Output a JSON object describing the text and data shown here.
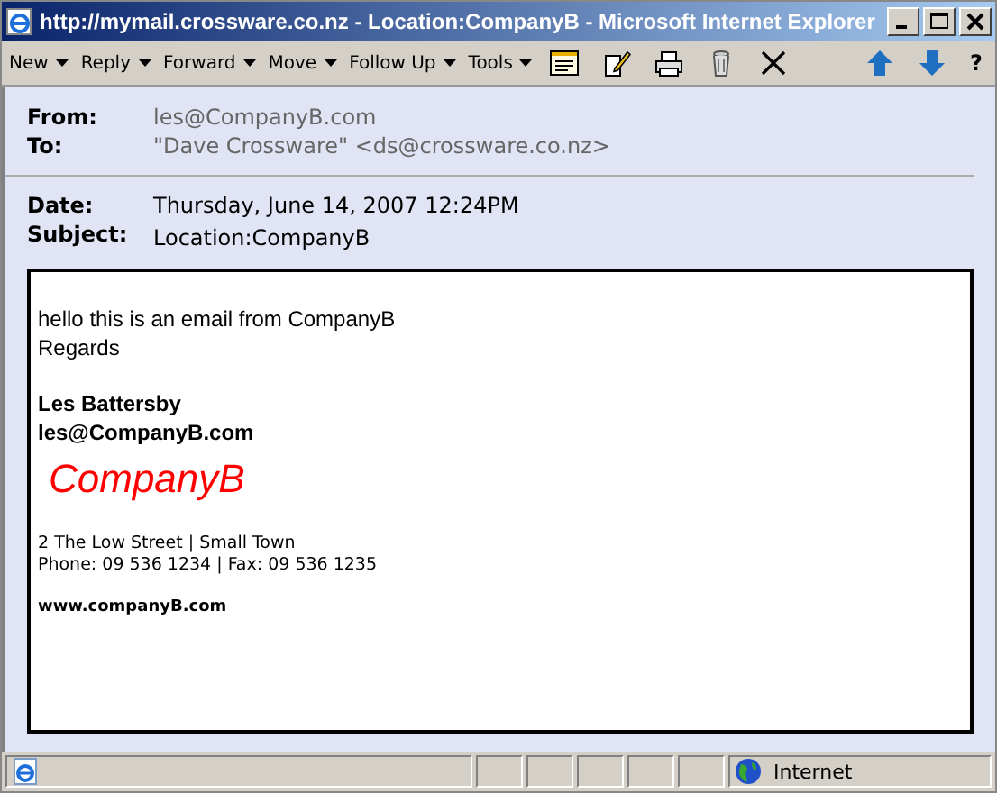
{
  "window": {
    "title": "http://mymail.crossware.co.nz - Location:CompanyB - Microsoft Internet Explorer"
  },
  "toolbar": {
    "menus": [
      "New",
      "Reply",
      "Forward",
      "Move",
      "Follow Up",
      "Tools"
    ],
    "help": "?"
  },
  "header": {
    "from_label": "From:",
    "from": "les@CompanyB.com",
    "to_label": "To:",
    "to": "\"Dave Crossware\" <ds@crossware.co.nz>",
    "date_label": "Date:",
    "date": "Thursday, June 14, 2007 12:24PM",
    "subject_label": "Subject:",
    "subject": "Location:CompanyB"
  },
  "body": {
    "lines": [
      "hello this is an email from CompanyB",
      "Regards"
    ],
    "signature_name": "Les Battersby",
    "signature_email": "les@CompanyB.com",
    "logo": "CompanyB",
    "address": "2 The Low Street | Small Town",
    "phone": "Phone: 09 536 1234 | Fax: 09 536 1235",
    "website": "www.companyB.com"
  },
  "status_bar": {
    "zone": "Internet"
  }
}
